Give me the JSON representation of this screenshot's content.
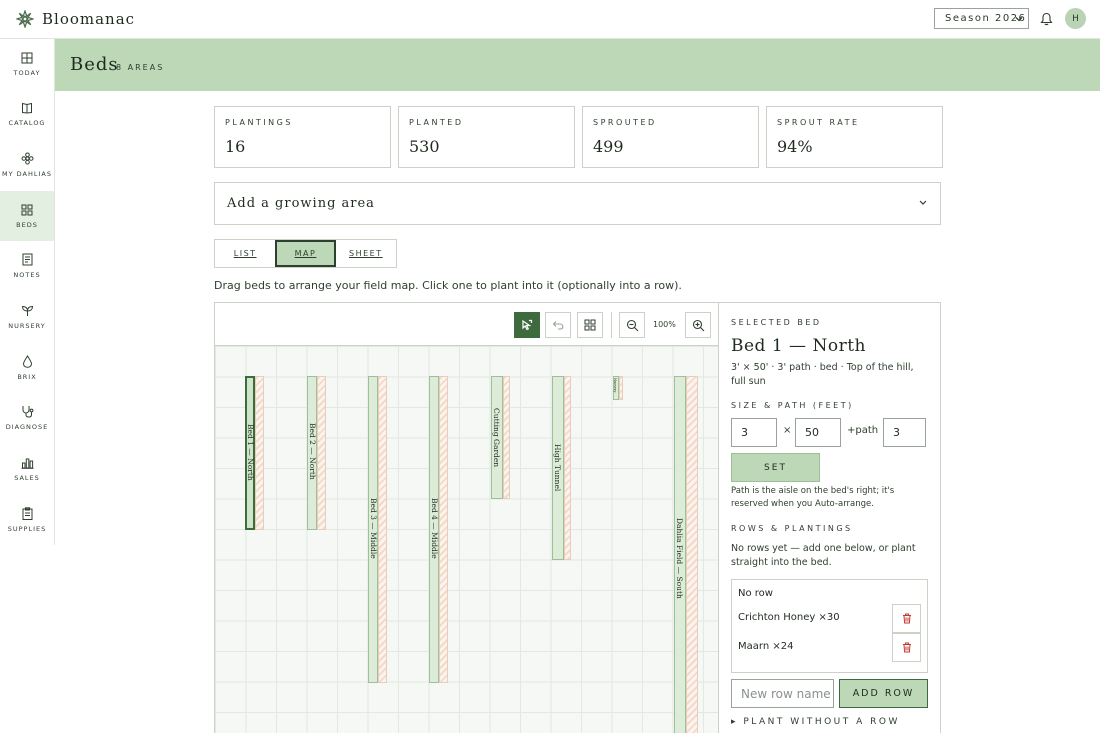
{
  "app": {
    "name": "Bloomanac"
  },
  "header": {
    "season": "Season 2026",
    "avatar_initial": "H"
  },
  "sidebar": {
    "items": [
      {
        "label": "TODAY",
        "icon": "grid-icon"
      },
      {
        "label": "CATALOG",
        "icon": "book-icon"
      },
      {
        "label": "MY DAHLIAS",
        "icon": "flower-icon"
      },
      {
        "label": "BEDS",
        "icon": "beds-icon"
      },
      {
        "label": "NOTES",
        "icon": "note-icon"
      },
      {
        "label": "NURSERY",
        "icon": "sprout-icon"
      },
      {
        "label": "BRIX",
        "icon": "drop-icon"
      },
      {
        "label": "DIAGNOSE",
        "icon": "diagnose-icon"
      },
      {
        "label": "SALES",
        "icon": "chart-icon"
      },
      {
        "label": "SUPPLIES",
        "icon": "clipboard-icon"
      }
    ]
  },
  "page": {
    "title": "Beds",
    "subtitle": "8 AREAS"
  },
  "stats": [
    {
      "label": "PLANTINGS",
      "value": "16"
    },
    {
      "label": "PLANTED",
      "value": "530"
    },
    {
      "label": "SPROUTED",
      "value": "499"
    },
    {
      "label": "SPROUT RATE",
      "value": "94%"
    }
  ],
  "add_area": {
    "label": "Add a growing area"
  },
  "tabs": [
    {
      "label": "LIST"
    },
    {
      "label": "MAP"
    },
    {
      "label": "SHEET"
    }
  ],
  "hint": "Drag beds to arrange your field map. Click one to plant into it (optionally into a row).",
  "map": {
    "zoom": "100%",
    "beds": [
      {
        "label": "Bed 1 — North"
      },
      {
        "label": "Bed 2 — North"
      },
      {
        "label": "Bed 3 — Middle"
      },
      {
        "label": "Bed 4 — Middle"
      },
      {
        "label": "Cutting Garden"
      },
      {
        "label": "High Tunnel"
      },
      {
        "label": "Nursery"
      },
      {
        "label": "Dahlia Field — South"
      }
    ]
  },
  "selected_bed": {
    "eyebrow": "SELECTED BED",
    "title": "Bed 1 — North",
    "description": "3' × 50' · 3' path · bed · Top of the hill, full sun",
    "size_label": "SIZE & PATH (FEET)",
    "width": "3",
    "length": "50",
    "times": "×",
    "path_label": "+path",
    "path": "3",
    "set_label": "SET",
    "path_note": "Path is the aisle on the bed's right; it's reserved when you Auto-arrange.",
    "rows_label": "ROWS & PLANTINGS",
    "rows_note": "No rows yet — add one below, or plant straight into the bed.",
    "row_group": "No row",
    "plantings": [
      {
        "text": "Crichton Honey ×30"
      },
      {
        "text": "Maarn ×24"
      }
    ],
    "new_row_placeholder": "New row name",
    "add_row_label": "ADD ROW",
    "plant_without": "▸ PLANT WITHOUT A ROW"
  }
}
